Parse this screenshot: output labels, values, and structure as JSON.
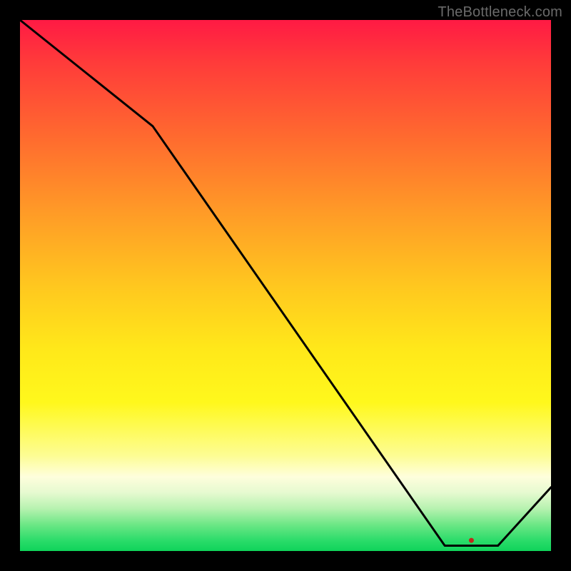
{
  "watermark": "TheBottleneck.com",
  "chart_data": {
    "type": "line",
    "title": "",
    "xlabel": "",
    "ylabel": "",
    "xlim": [
      0,
      100
    ],
    "ylim": [
      0,
      100
    ],
    "data_points": [
      {
        "x": 0,
        "y": 100
      },
      {
        "x": 25,
        "y": 80
      },
      {
        "x": 80,
        "y": 1
      },
      {
        "x": 90,
        "y": 1
      },
      {
        "x": 100,
        "y": 12
      }
    ],
    "annotation": {
      "text": "",
      "x": 85,
      "y": 2
    },
    "background_gradient": {
      "top_color": "#ff1a44",
      "bottom_color": "#0fd35a"
    }
  }
}
